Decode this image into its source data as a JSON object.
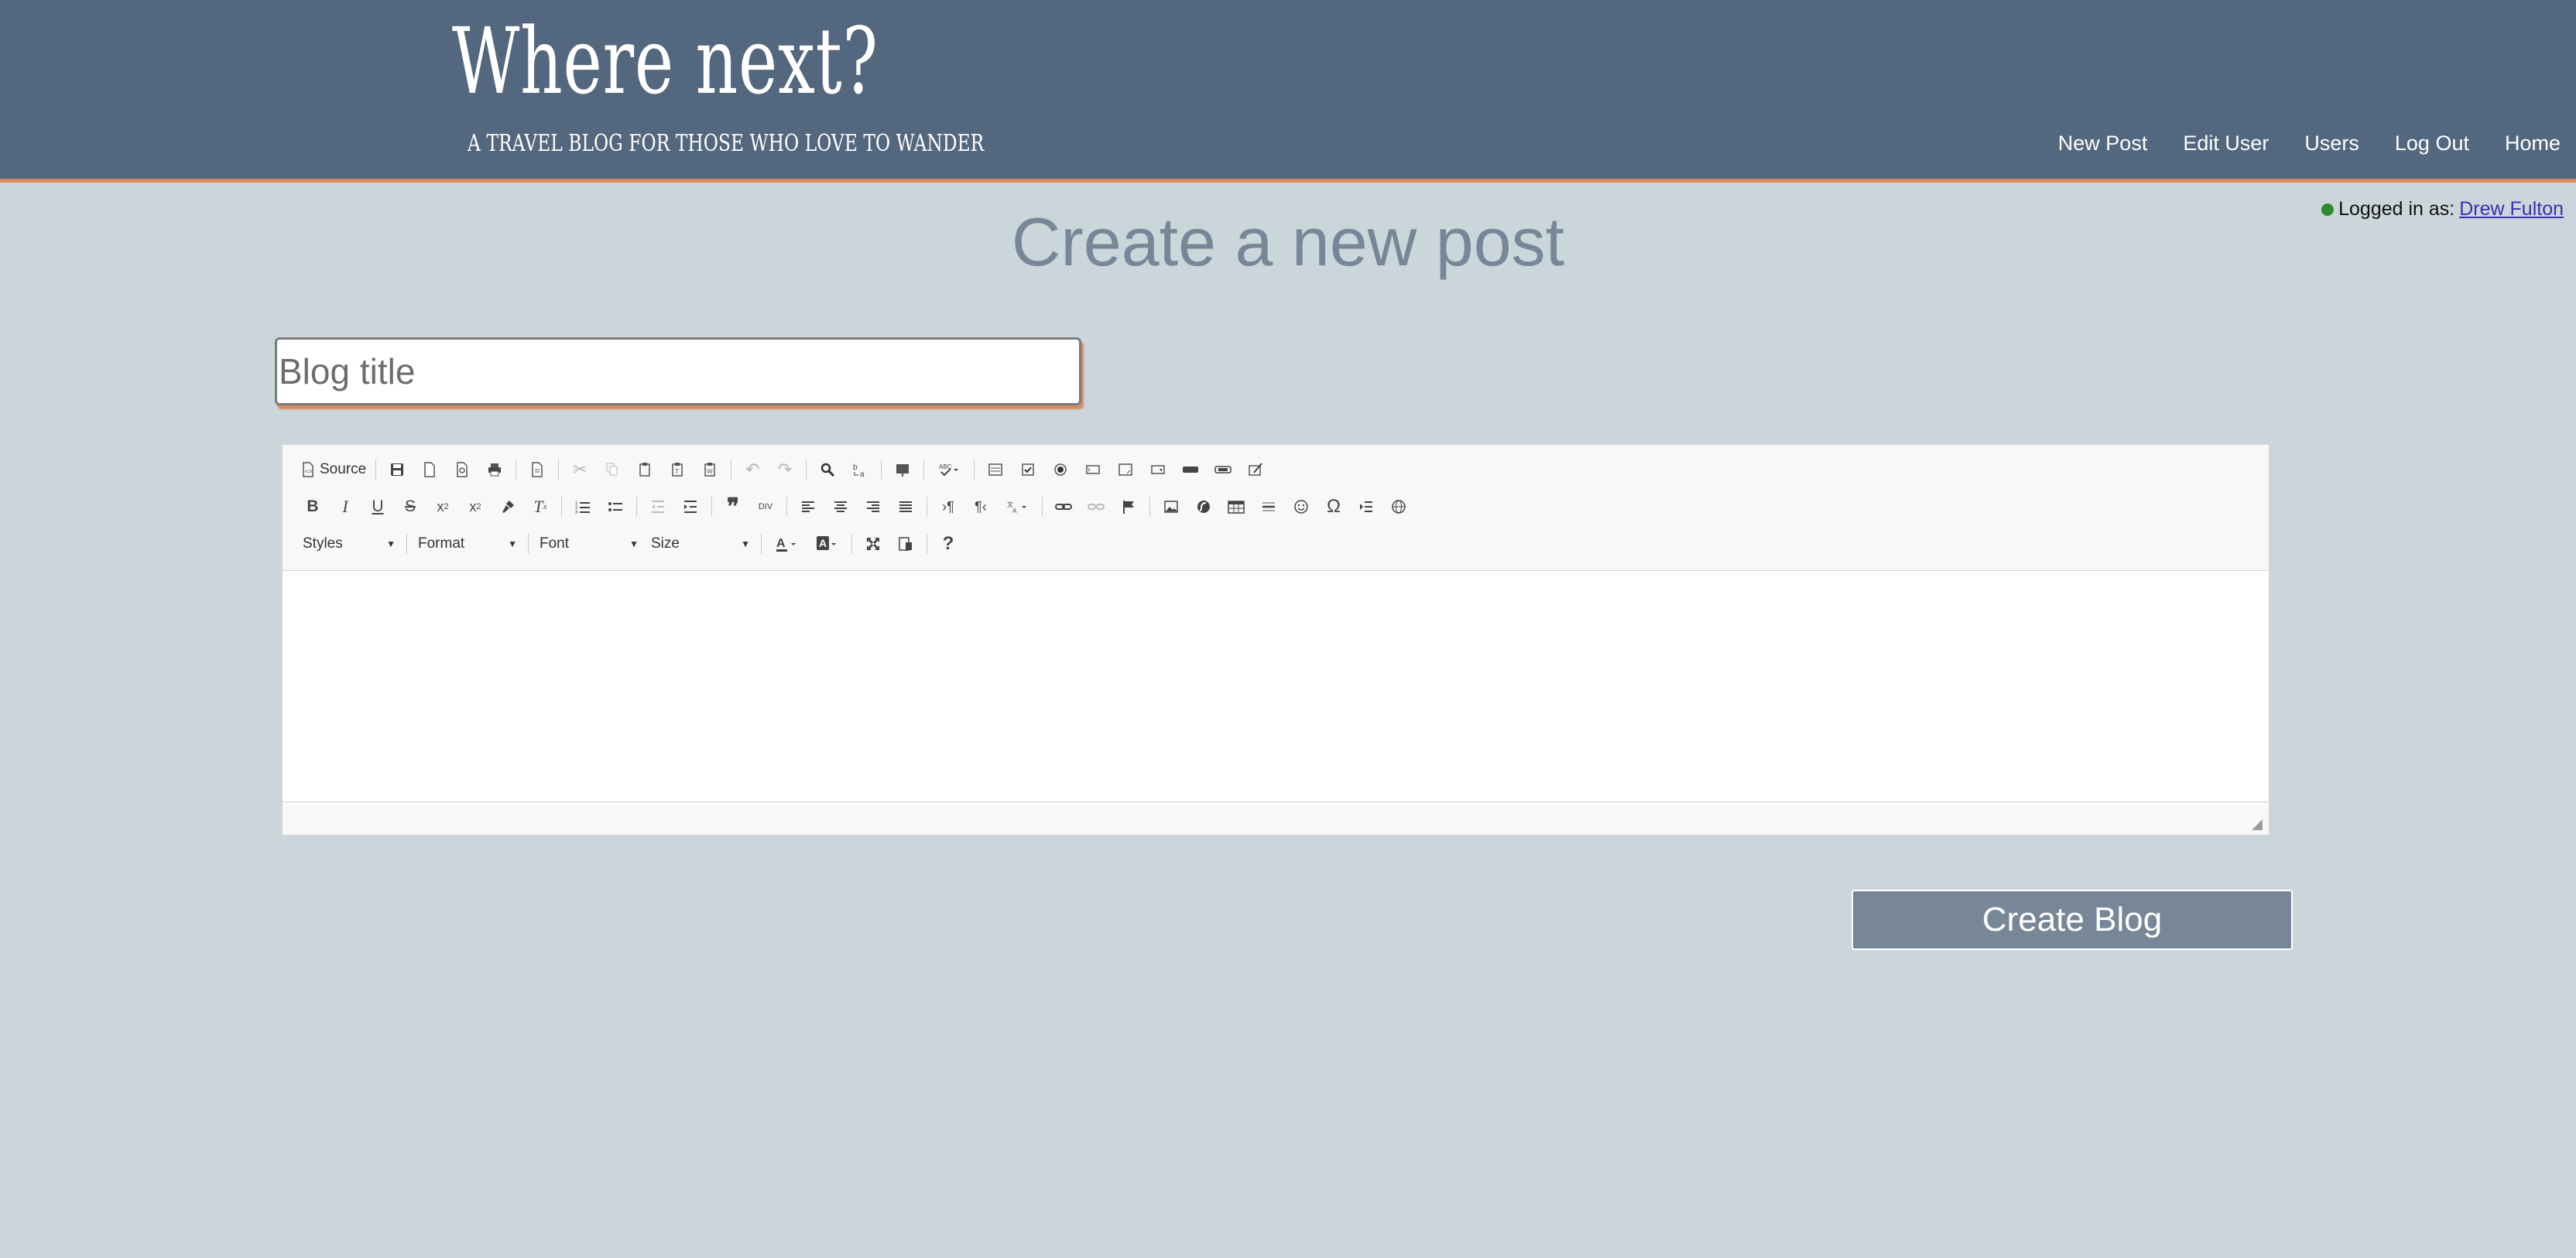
{
  "header": {
    "logo_title": "Where next?",
    "logo_subtitle": "A travel blog for those who love to wander",
    "nav": [
      "New Post",
      "Edit User",
      "Users",
      "Log Out",
      "Home"
    ]
  },
  "login": {
    "label": "Logged in as:",
    "user": "Drew Fulton"
  },
  "page_title": "Create a new post",
  "title_input": {
    "placeholder": "Blog title",
    "value": ""
  },
  "editor": {
    "source_label": "Source",
    "styles_label": "Styles",
    "format_label": "Format",
    "font_label": "Font",
    "size_label": "Size"
  },
  "create_button": "Create Blog",
  "colors": {
    "header_bg": "#53677f",
    "accent": "#d9895f",
    "page_bg": "#cbd6db",
    "button_bg": "#778797"
  }
}
